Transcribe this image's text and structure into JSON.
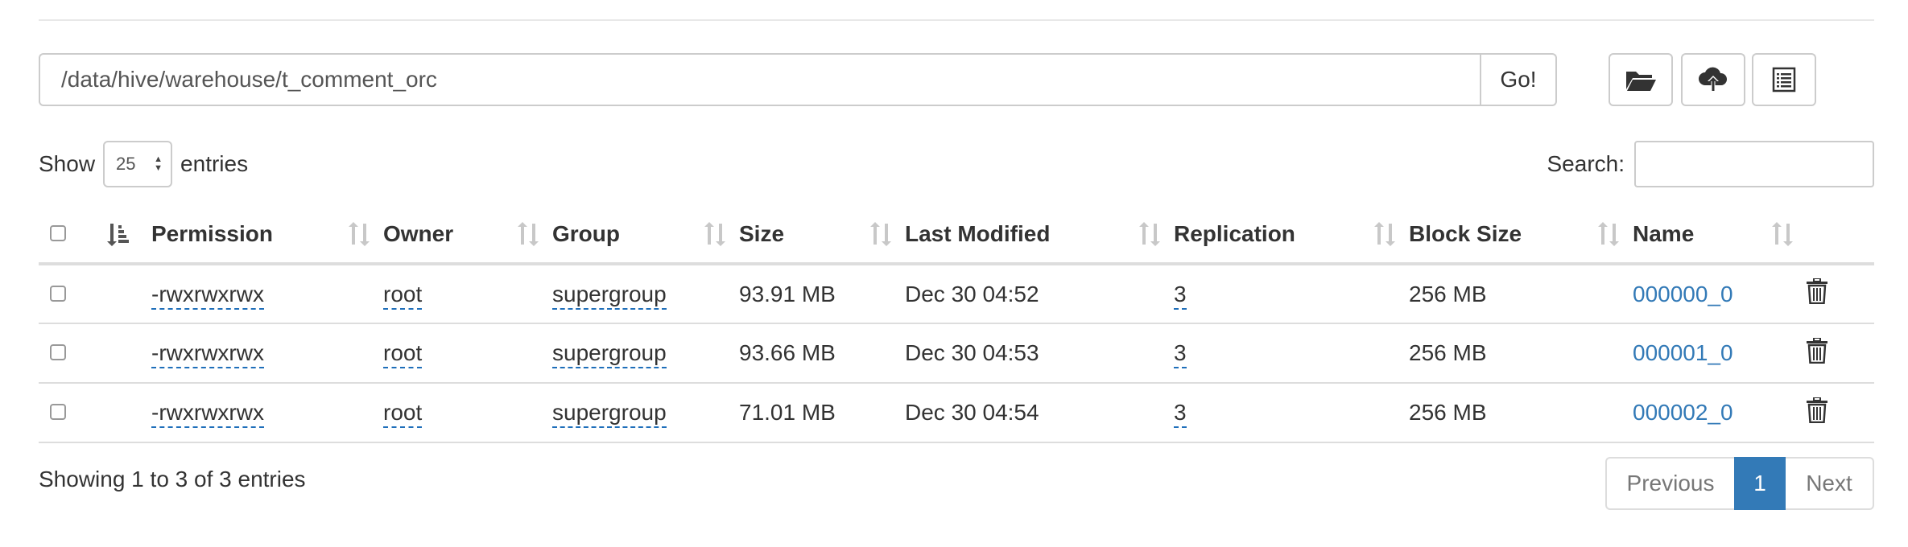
{
  "path_bar": {
    "value": "/data/hive/warehouse/t_comment_orc",
    "go_label": "Go!"
  },
  "toolbar": {
    "icons": [
      "folder-open-icon",
      "cloud-upload-icon",
      "list-icon"
    ]
  },
  "length": {
    "prefix": "Show",
    "value": "25",
    "suffix": "entries"
  },
  "search": {
    "label": "Search:",
    "value": ""
  },
  "table": {
    "headers": [
      "Permission",
      "Owner",
      "Group",
      "Size",
      "Last Modified",
      "Replication",
      "Block Size",
      "Name"
    ],
    "rows": [
      {
        "permission": "-rwxrwxrwx",
        "owner": "root",
        "group": "supergroup",
        "size": "93.91 MB",
        "modified": "Dec 30 04:52",
        "replication": "3",
        "block_size": "256 MB",
        "name": "000000_0"
      },
      {
        "permission": "-rwxrwxrwx",
        "owner": "root",
        "group": "supergroup",
        "size": "93.66 MB",
        "modified": "Dec 30 04:53",
        "replication": "3",
        "block_size": "256 MB",
        "name": "000001_0"
      },
      {
        "permission": "-rwxrwxrwx",
        "owner": "root",
        "group": "supergroup",
        "size": "71.01 MB",
        "modified": "Dec 30 04:54",
        "replication": "3",
        "block_size": "256 MB",
        "name": "000002_0"
      }
    ]
  },
  "footer": {
    "info": "Showing 1 to 3 of 3 entries",
    "previous": "Previous",
    "current_page": "1",
    "next": "Next"
  },
  "colors": {
    "link": "#337ab7",
    "active_page": "#337ab7",
    "border": "#dddddd"
  }
}
